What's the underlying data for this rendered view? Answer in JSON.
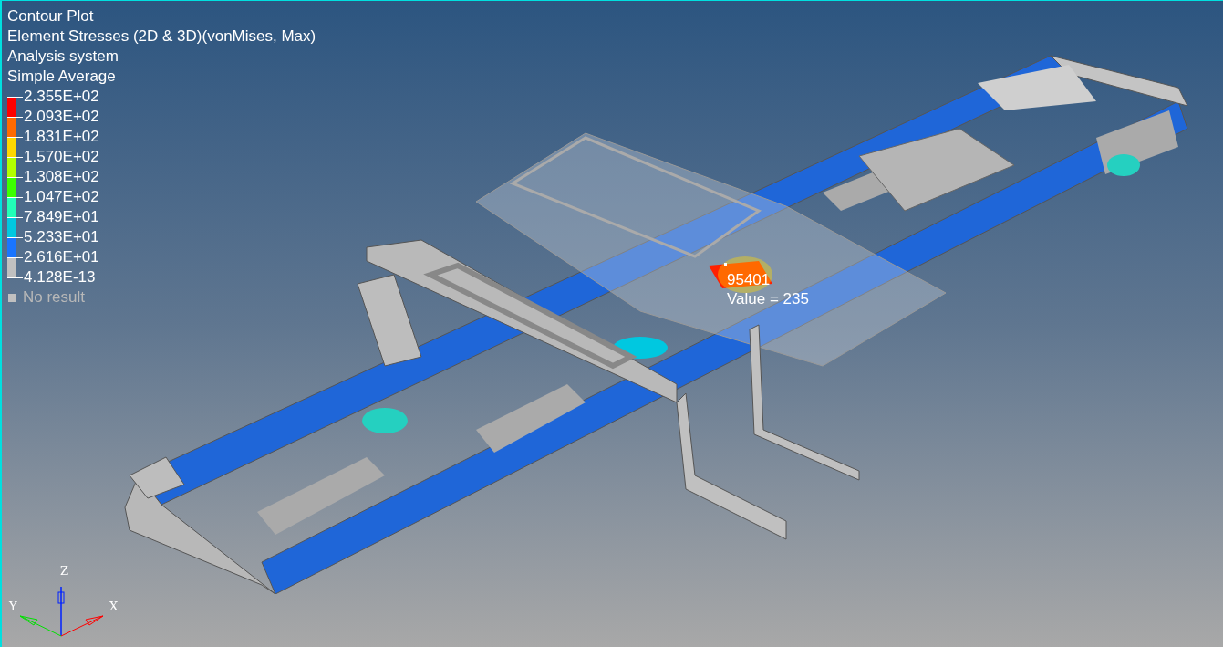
{
  "legend": {
    "title": "Contour Plot",
    "result_type": "Element Stresses (2D & 3D)(vonMises, Max)",
    "system": "Analysis system",
    "averaging": "Simple Average",
    "levels": [
      "2.355E+02",
      "2.093E+02",
      "1.831E+02",
      "1.570E+02",
      "1.308E+02",
      "1.047E+02",
      "7.849E+01",
      "5.233E+01",
      "2.616E+01",
      "4.128E-13"
    ],
    "bands": [
      {
        "color": "#ff0000"
      },
      {
        "color": "#ff6a00"
      },
      {
        "color": "#ffd800"
      },
      {
        "color": "#b2ff00"
      },
      {
        "color": "#3cff00"
      },
      {
        "color": "#21ffb8"
      },
      {
        "color": "#00c8e0"
      },
      {
        "color": "#1a75ff"
      },
      {
        "color": "#c0c0c0"
      }
    ],
    "no_result": "No result"
  },
  "probe": {
    "id": "95401",
    "value": "Value = 235"
  },
  "triad": {
    "z": "Z",
    "y": "Y",
    "x": "X"
  }
}
